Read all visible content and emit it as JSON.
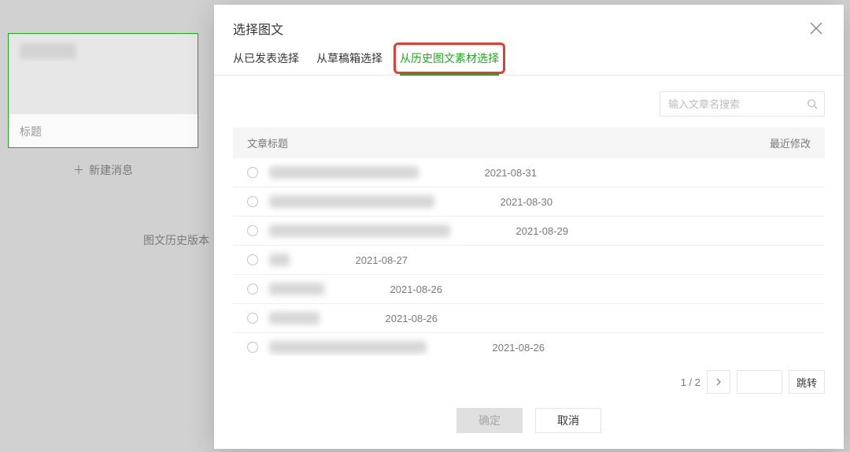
{
  "background": {
    "title_label": "标题",
    "new_message": "新建消息",
    "history_label": "图文历史版本"
  },
  "modal": {
    "title": "选择图文",
    "tabs": [
      {
        "label": "从已发表选择",
        "active": false
      },
      {
        "label": "从草稿箱选择",
        "active": false
      },
      {
        "label": "从历史图文素材选择",
        "active": true,
        "highlighted": true
      }
    ],
    "search": {
      "placeholder": "输入文章名搜索"
    },
    "table": {
      "header_title": "文章标题",
      "header_date": "最近修改",
      "rows": [
        {
          "title_blur_width": 190,
          "date": "2021-08-31"
        },
        {
          "title_blur_width": 210,
          "date": "2021-08-30"
        },
        {
          "title_blur_width": 230,
          "date": "2021-08-29"
        },
        {
          "title_blur_width": 26,
          "date": "2021-08-27"
        },
        {
          "title_blur_width": 70,
          "date": "2021-08-26"
        },
        {
          "title_blur_width": 64,
          "date": "2021-08-26"
        },
        {
          "title_blur_width": 200,
          "date": "2021-08-26"
        }
      ]
    },
    "pagination": {
      "text": "1 / 2",
      "jump_label": "跳转"
    },
    "buttons": {
      "confirm": "确定",
      "cancel": "取消"
    }
  }
}
